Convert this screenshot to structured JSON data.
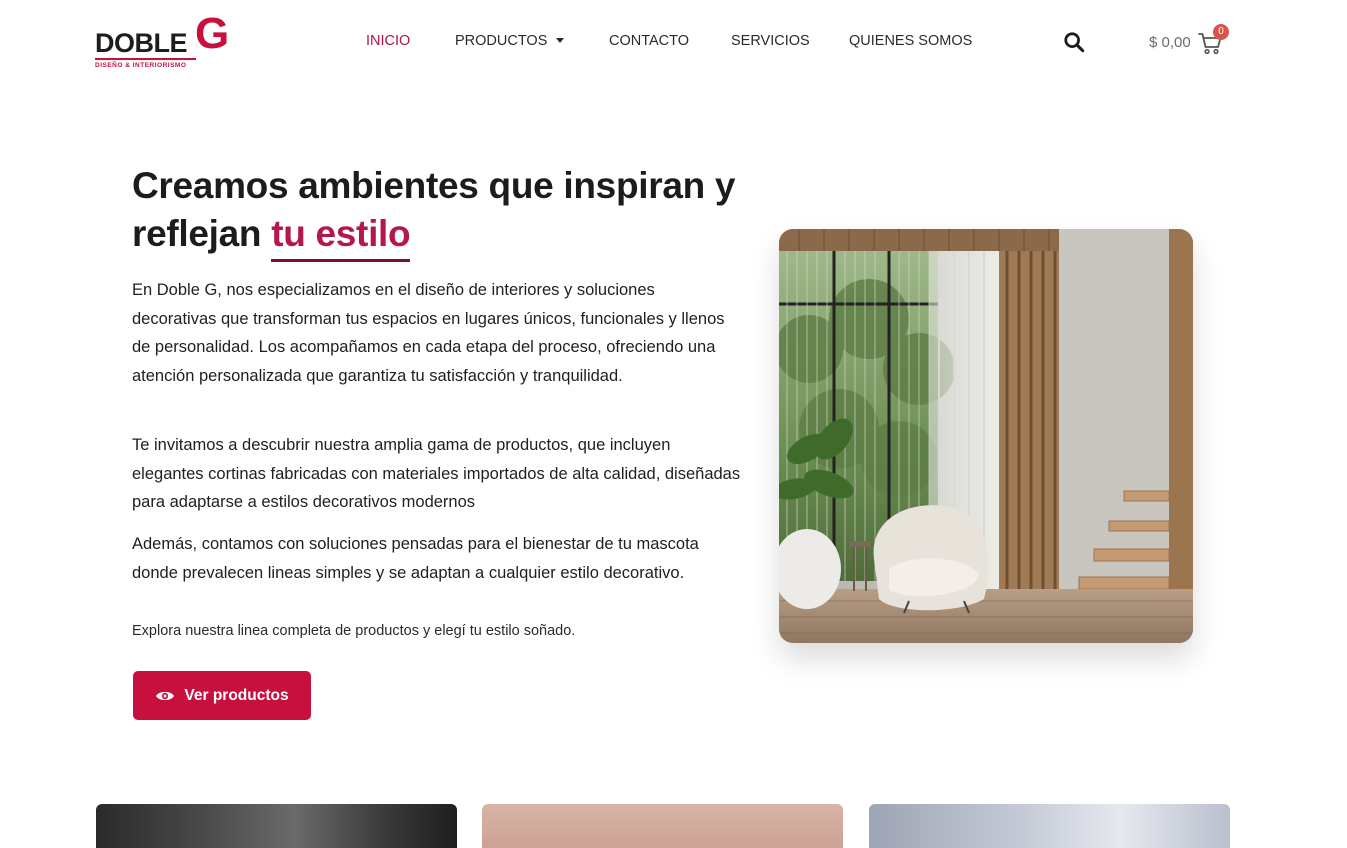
{
  "brand": {
    "name": "DOBLE",
    "letter": "G",
    "tagline": "DISEÑO & INTERIORISMO",
    "accent_color": "#c8103f"
  },
  "nav": {
    "items": [
      {
        "label": "INICIO",
        "active": true
      },
      {
        "label": "PRODUCTOS",
        "has_dropdown": true
      },
      {
        "label": "CONTACTO"
      },
      {
        "label": "SERVICIOS"
      },
      {
        "label": "QUIENES SOMOS"
      }
    ]
  },
  "header": {
    "search_icon": "search-icon",
    "cart_total": "$ 0,00",
    "cart_count": "0",
    "cart_icon": "cart-icon"
  },
  "hero": {
    "title_part1": "Creamos ambientes que inspiran y reflejan ",
    "title_highlight": "tu estilo",
    "paragraphs": [
      "En Doble G, nos especializamos en el diseño de interiores y soluciones decorativas que transforman tus espacios en lugares únicos, funcionales y llenos de personalidad. Los acompañamos en cada etapa del proceso, ofreciendo una atención personalizada que garantiza tu satisfacción y tranquilidad.",
      "Te invitamos a descubrir nuestra amplia gama de productos, que incluyen elegantes cortinas fabricadas con materiales importados de alta calidad, diseñadas para adaptarse a estilos decorativos modernos",
      "Además, contamos con soluciones pensadas para el bienestar de tu mascota donde prevalecen lineas simples y se adaptan a cualquier estilo decorativo."
    ],
    "explore_text": "Explora nuestra linea completa de productos y elegí tu estilo soñado.",
    "cta_label": "Ver productos",
    "cta_icon": "eye-icon"
  }
}
